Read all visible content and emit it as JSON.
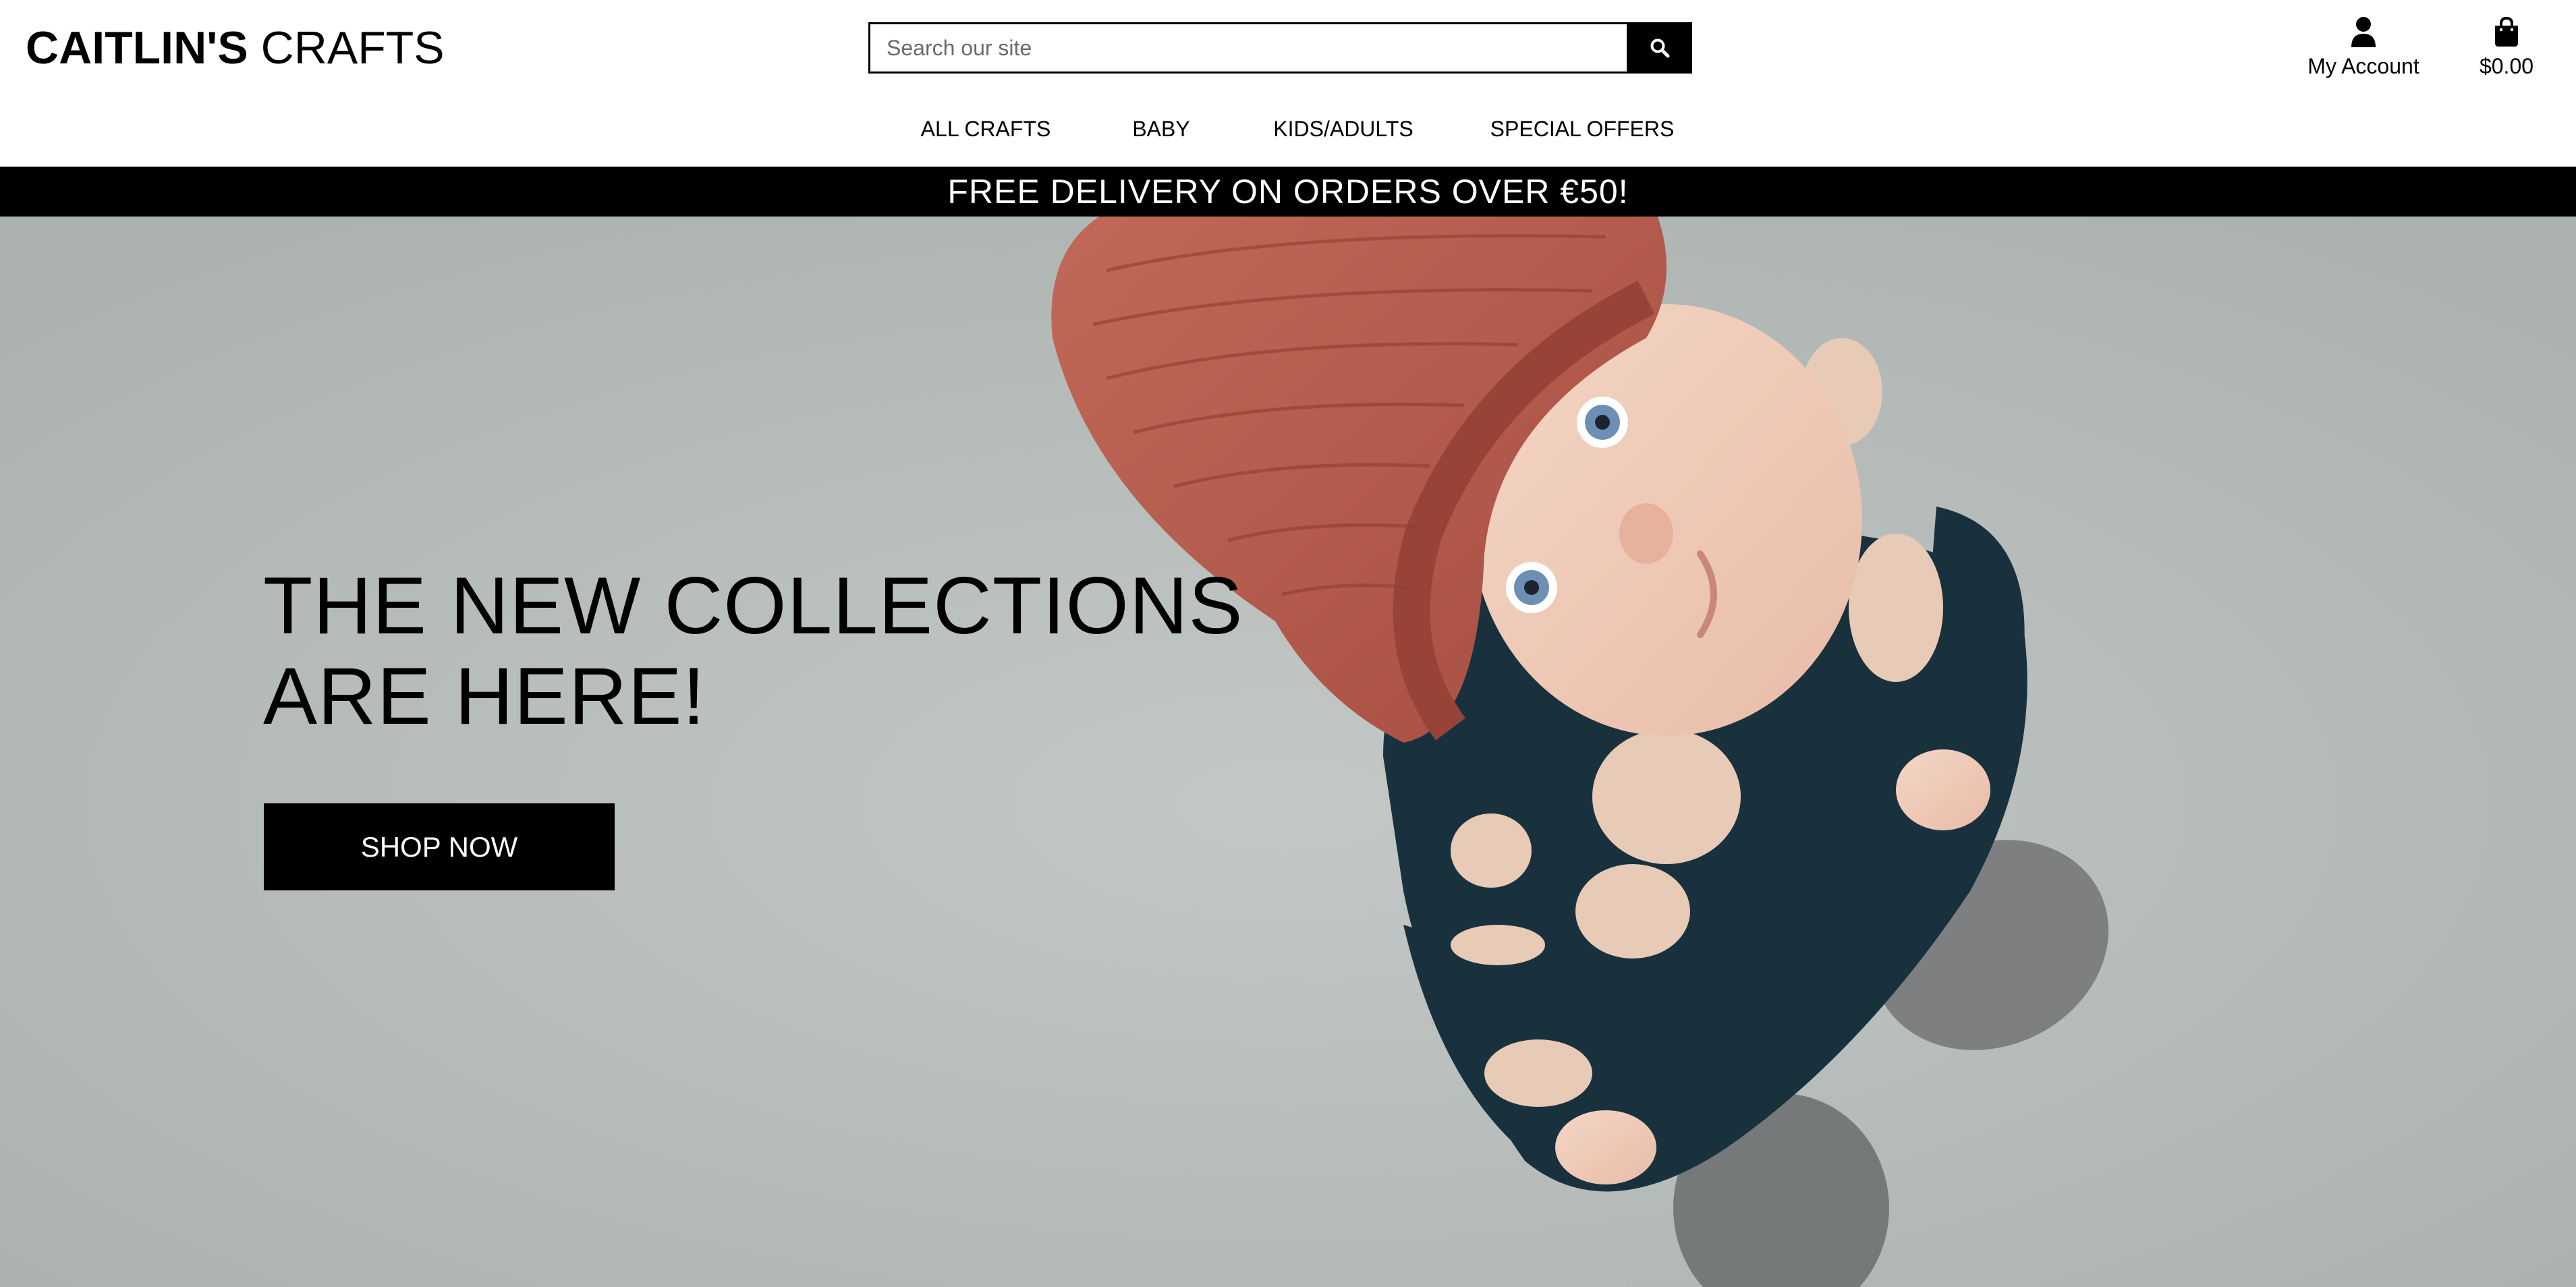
{
  "header": {
    "brand_bold": "CAITLIN'S",
    "brand_light": "CRAFTS",
    "search_placeholder": "Search our site",
    "search_icon": "magnifier-icon",
    "account_label": "My Account",
    "account_icon": "user-icon",
    "cart_total": "$0.00",
    "cart_icon": "shopping-bag-icon"
  },
  "nav": {
    "items": [
      "ALL CRAFTS",
      "BABY",
      "KIDS/ADULTS",
      "SPECIAL OFFERS"
    ]
  },
  "banner": {
    "text": "FREE DELIVERY ON ORDERS OVER €50!"
  },
  "hero": {
    "title_line1": "THE NEW COLLECTIONS",
    "title_line2": "ARE HERE!",
    "cta_label": "SHOP NOW"
  },
  "colors": {
    "primary": "#000000",
    "background": "#ffffff",
    "hero_bg": "#b6bcba",
    "hat": "#b5584a",
    "onesie": "#18313d",
    "socks": "#7d7f80"
  }
}
